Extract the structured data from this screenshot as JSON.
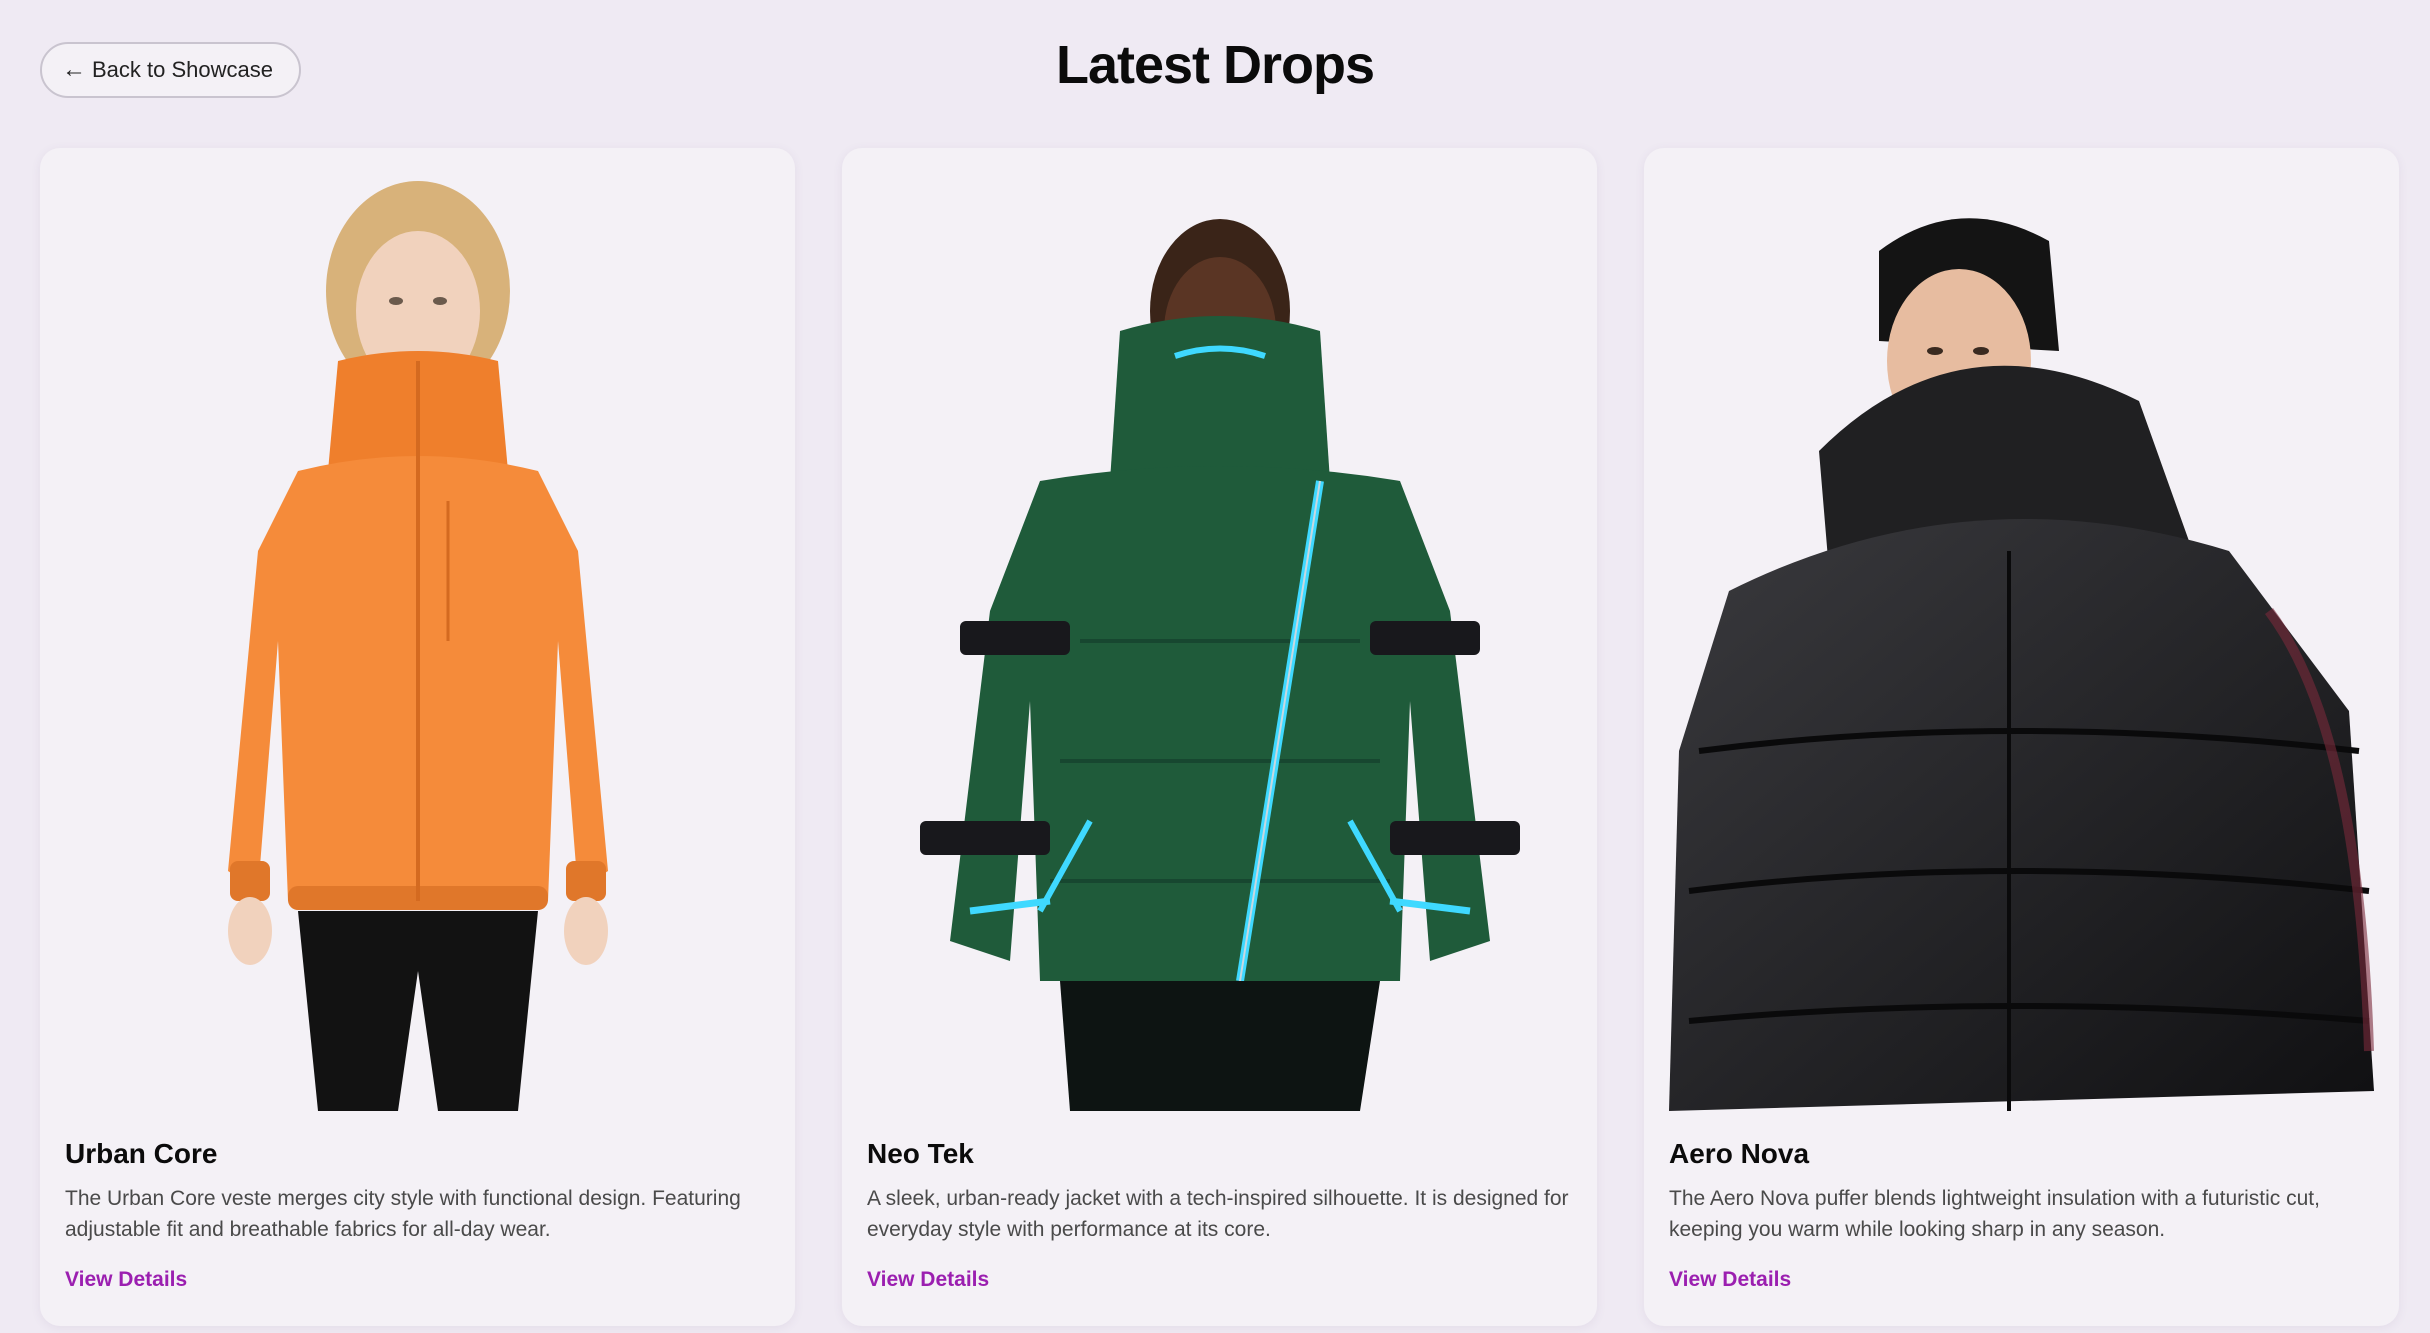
{
  "header": {
    "back_label": "Back to Showcase",
    "back_arrow": "←",
    "title": "Latest Drops"
  },
  "products": [
    {
      "name": "Urban Core",
      "description": "The Urban Core veste merges city style with functional design. Featuring adjustable fit and breathable fabrics for all-day wear.",
      "link_label": "View Details",
      "jacket_color": "#f58b3a"
    },
    {
      "name": "Neo Tek",
      "description": "A sleek, urban-ready jacket with a tech-inspired silhouette. It is designed for everyday style with performance at its core.",
      "link_label": "View Details",
      "jacket_color": "#1f5b3a"
    },
    {
      "name": "Aero Nova",
      "description": "The Aero Nova puffer blends lightweight insulation with a futuristic cut, keeping you warm while looking sharp in any season.",
      "link_label": "View Details",
      "jacket_color": "#1e1e20"
    }
  ],
  "colors": {
    "background": "#efeaf3",
    "card": "#f4f1f6",
    "accent": "#9b1fb0"
  }
}
